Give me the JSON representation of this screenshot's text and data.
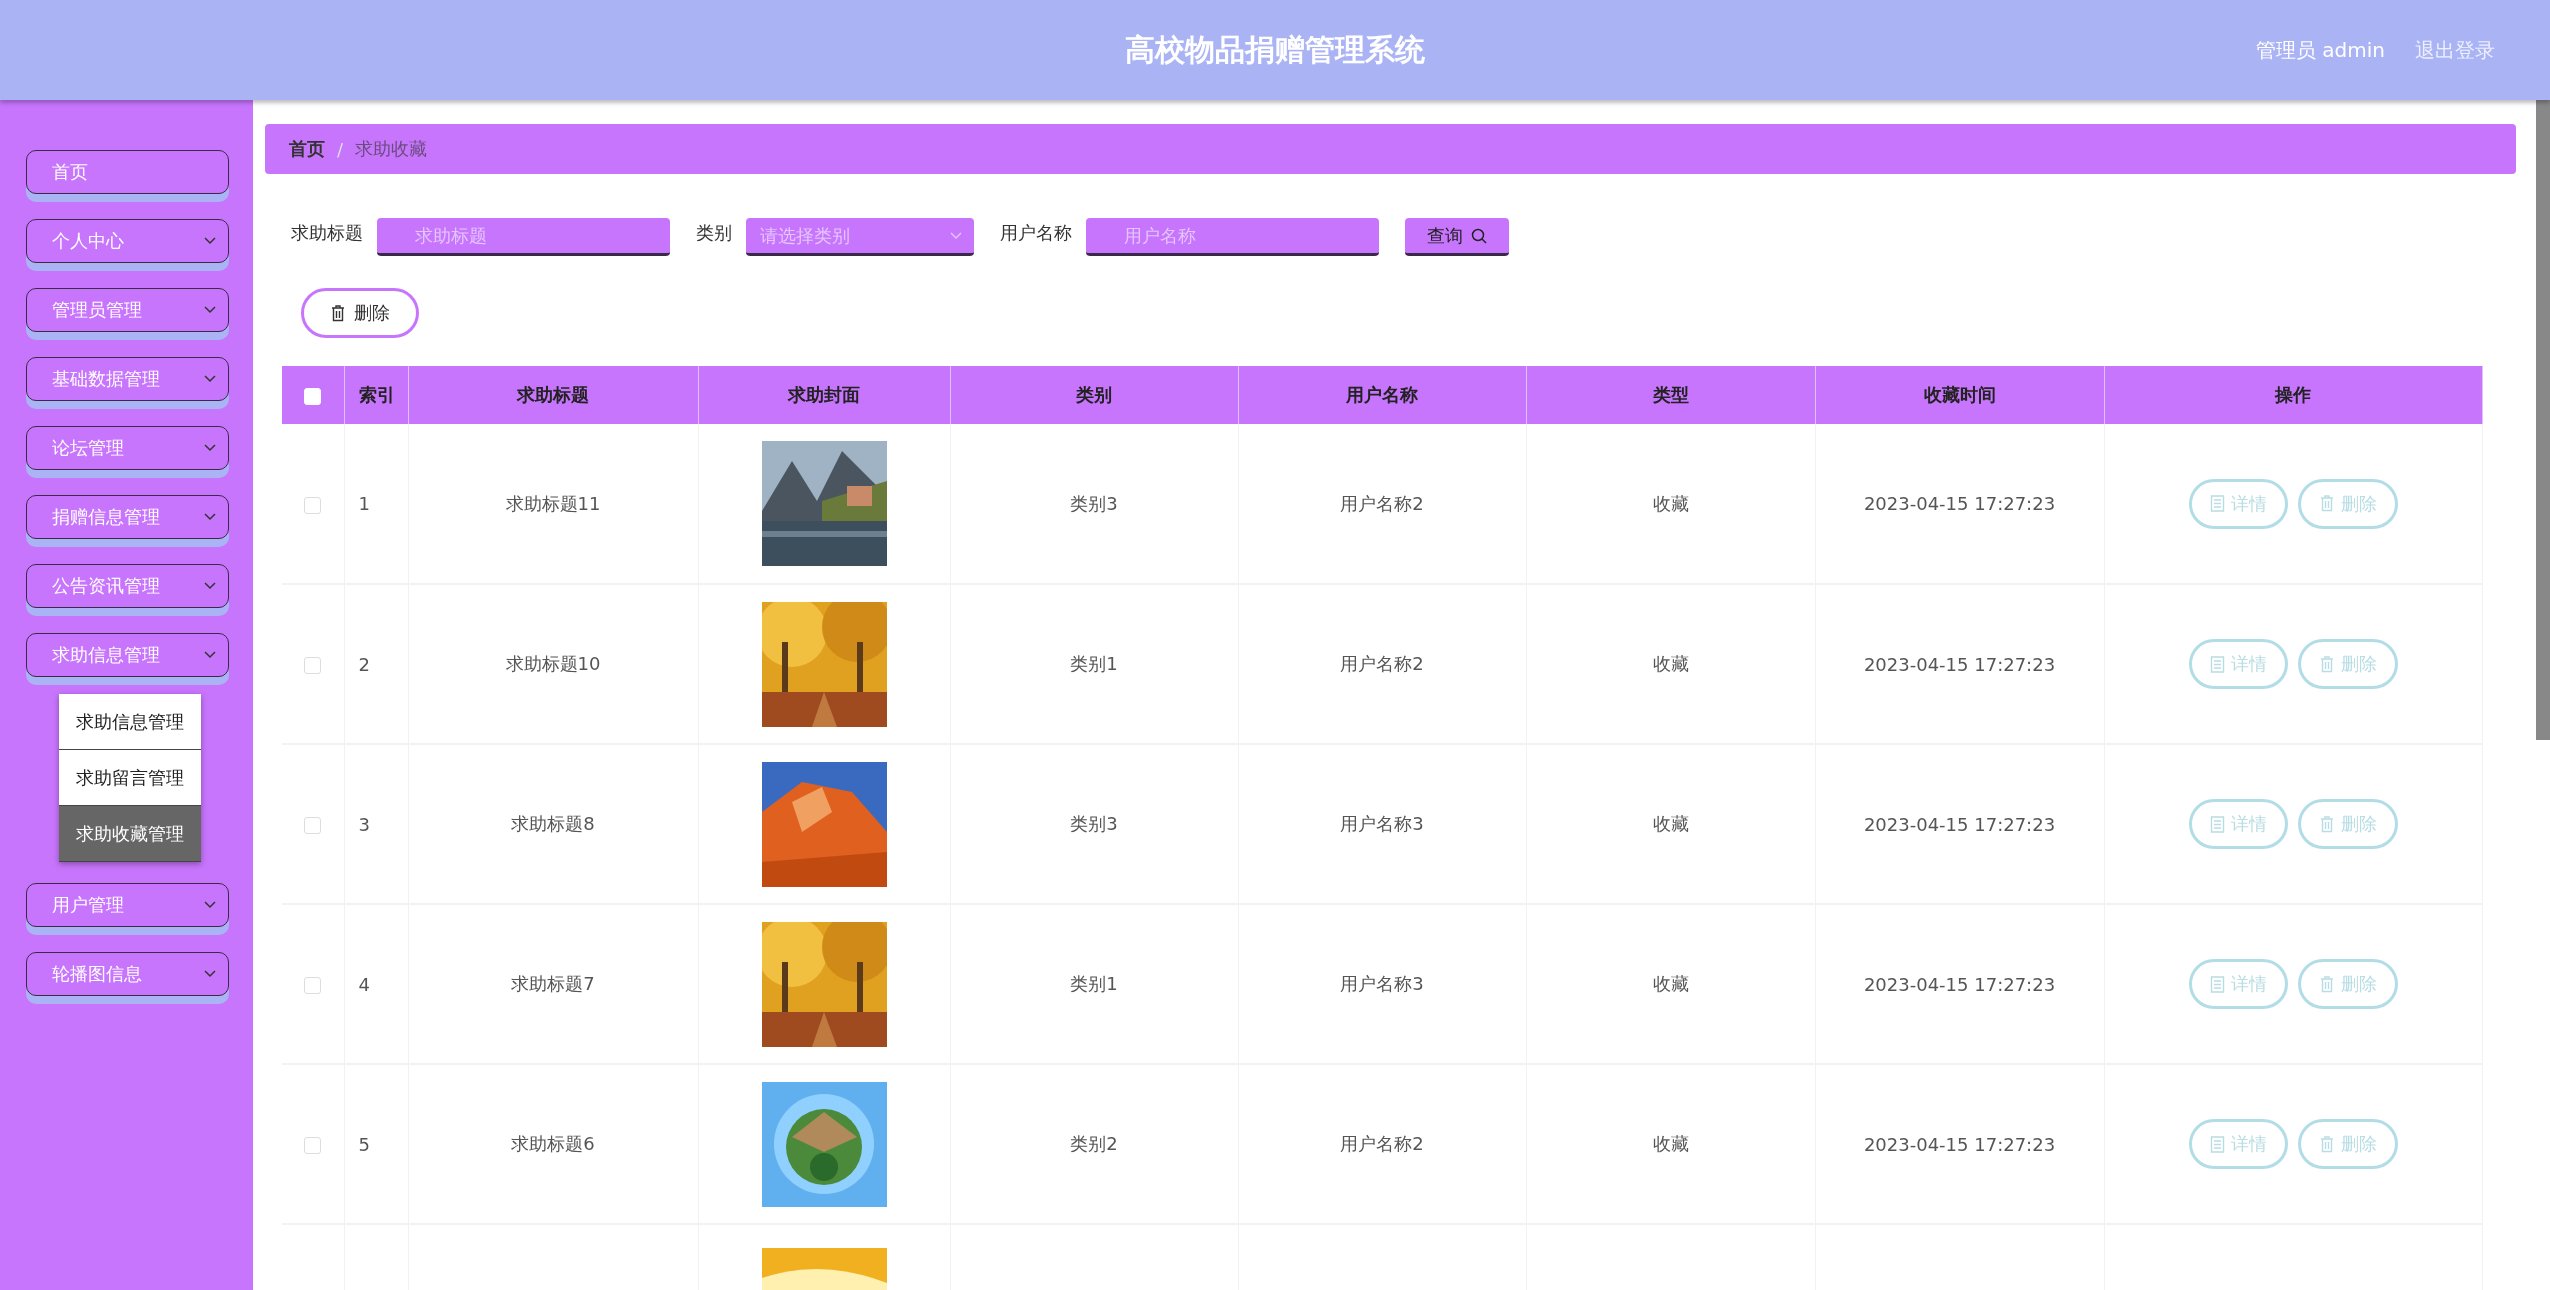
{
  "header": {
    "title": "高校物品捐赠管理系统",
    "user": "管理员 admin",
    "logout": "退出登录"
  },
  "sidebar": {
    "items": [
      {
        "label": "首页",
        "kind": "link"
      },
      {
        "label": "个人中心",
        "kind": "dropdown"
      },
      {
        "label": "管理员管理",
        "kind": "dropdown"
      },
      {
        "label": "基础数据管理",
        "kind": "dropdown"
      },
      {
        "label": "论坛管理",
        "kind": "dropdown"
      },
      {
        "label": "捐赠信息管理",
        "kind": "dropdown"
      },
      {
        "label": "公告资讯管理",
        "kind": "dropdown"
      },
      {
        "label": "求助信息管理",
        "kind": "dropdown",
        "children": [
          {
            "label": "求助信息管理",
            "selected": false
          },
          {
            "label": "求助留言管理",
            "selected": false
          },
          {
            "label": "求助收藏管理",
            "selected": true
          }
        ]
      },
      {
        "label": "用户管理",
        "kind": "dropdown"
      },
      {
        "label": "轮播图信息",
        "kind": "dropdown"
      }
    ]
  },
  "breadcrumb": {
    "items": [
      "首页",
      "求助收藏"
    ],
    "separator": "/"
  },
  "search": {
    "fields": [
      {
        "label": "求助标题",
        "kind": "input",
        "placeholder": "求助标题"
      },
      {
        "label": "类别",
        "kind": "select",
        "placeholder": "请选择类别"
      },
      {
        "label": "用户名称",
        "kind": "input",
        "placeholder": "用户名称"
      }
    ],
    "button": "查询"
  },
  "delete_button": "删除",
  "table": {
    "select_all_checked": false,
    "columns": [
      "索引",
      "求助标题",
      "求助封面",
      "类别",
      "用户名称",
      "类型",
      "收藏时间",
      "操作"
    ],
    "rows": [
      {
        "index": "1",
        "title": "求助标题11",
        "cover": {
          "kind": "picture"
        },
        "category": "类别3",
        "user": "用户名称2",
        "type": "收藏",
        "time": "2023-04-15 17:27:23",
        "checked": false,
        "actions": [
          "详情",
          "删除"
        ]
      },
      {
        "index": "2",
        "title": "求助标题10",
        "cover": {
          "kind": "picture"
        },
        "category": "类别1",
        "user": "用户名称2",
        "type": "收藏",
        "time": "2023-04-15 17:27:23",
        "checked": false,
        "actions": [
          "详情",
          "删除"
        ]
      },
      {
        "index": "3",
        "title": "求助标题8",
        "cover": {
          "kind": "picture"
        },
        "category": "类别3",
        "user": "用户名称3",
        "type": "收藏",
        "time": "2023-04-15 17:27:23",
        "checked": false,
        "actions": [
          "详情",
          "删除"
        ]
      },
      {
        "index": "4",
        "title": "求助标题7",
        "cover": {
          "kind": "picture"
        },
        "category": "类别1",
        "user": "用户名称3",
        "type": "收藏",
        "time": "2023-04-15 17:27:23",
        "checked": false,
        "actions": [
          "详情",
          "删除"
        ]
      },
      {
        "index": "5",
        "title": "求助标题6",
        "cover": {
          "kind": "picture"
        },
        "category": "类别2",
        "user": "用户名称2",
        "type": "收藏",
        "time": "2023-04-15 17:27:23",
        "checked": false,
        "actions": [
          "详情",
          "删除"
        ]
      },
      {
        "cover": {
          "kind": "picture"
        }
      }
    ]
  }
}
